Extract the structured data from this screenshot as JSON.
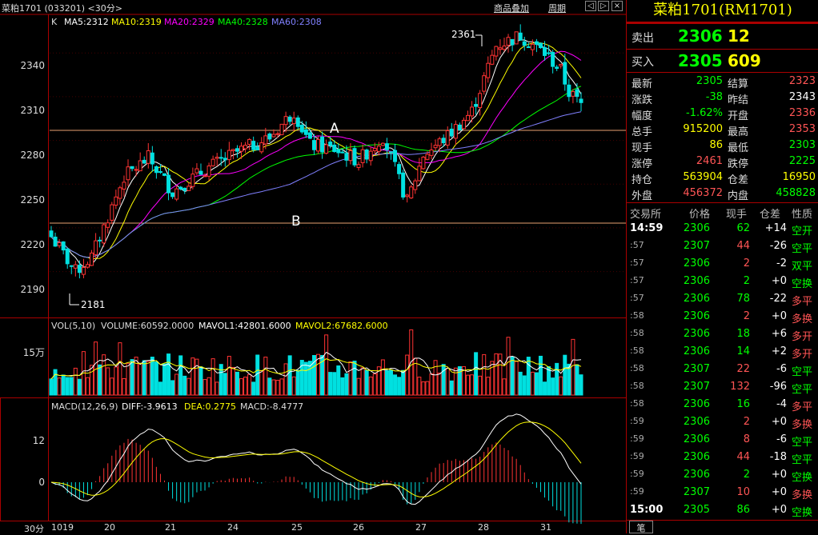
{
  "header": {
    "symbol_title": "菜粕1701 (033201) <30分>",
    "overlay_label": "商品叠加",
    "period_label": "周期"
  },
  "indicators": {
    "k_label": "K",
    "ma5": "MA5:2312",
    "ma10": "MA10:2319",
    "ma20": "MA20:2329",
    "ma40": "MA40:2328",
    "ma60": "MA60:2308",
    "vol_label": "VOL(5,10)",
    "volume": "VOLUME:60592.0000",
    "mavol1": "MAVOL1:42801.6000",
    "mavol2": "MAVOL2:67682.6000",
    "macd_label": "MACD(12,26,9)",
    "diff": "DIFF:-3.9613",
    "dea": "DEA:0.2775",
    "macd": "MACD:-8.4777"
  },
  "price_axis": [
    "2340",
    "2310",
    "2280",
    "2250",
    "2220",
    "2190"
  ],
  "vol_axis": [
    "15万"
  ],
  "macd_axis": [
    "12",
    "0"
  ],
  "annotations": {
    "high_mark": "2361",
    "low_mark": "2181",
    "line_a": "A",
    "line_b": "B"
  },
  "x_axis": {
    "period": "30分",
    "labels": [
      "1019",
      "20",
      "21",
      "24",
      "25",
      "26",
      "27",
      "28",
      "31"
    ]
  },
  "colors": {
    "up": "#ff3333",
    "down": "#00e0e0",
    "ma5": "#ffffff",
    "ma10": "#ffff00",
    "ma20": "#ff00ff",
    "ma40": "#00ff00",
    "ma60": "#8080ff"
  },
  "quote": {
    "title": "菜粕1701(RM1701)",
    "sell_label": "卖出",
    "sell_price": "2306",
    "sell_qty": "12",
    "buy_label": "买入",
    "buy_price": "2305",
    "buy_qty": "609",
    "stats": [
      [
        "最新",
        "2305",
        "结算",
        "2323"
      ],
      [
        "涨跌",
        "-38",
        "昨结",
        "2343"
      ],
      [
        "幅度",
        "-1.62%",
        "开盘",
        "2336"
      ],
      [
        "总手",
        "915200",
        "最高",
        "2353"
      ],
      [
        "现手",
        "86",
        "最低",
        "2303"
      ],
      [
        "涨停",
        "2461",
        "跌停",
        "2225"
      ],
      [
        "持仓",
        "563904",
        "仓差",
        "16950"
      ],
      [
        "外盘",
        "456372",
        "内盘",
        "458828"
      ]
    ]
  },
  "trades": {
    "headers": [
      "交易所",
      "价格",
      "现手",
      "仓差",
      "性质"
    ],
    "rows": [
      [
        "14:59",
        "2306",
        "62",
        "+14",
        "空开"
      ],
      [
        ":57",
        "2307",
        "44",
        "-26",
        "空平"
      ],
      [
        ":57",
        "2306",
        "2",
        "-2",
        "双平"
      ],
      [
        ":57",
        "2306",
        "2",
        "+0",
        "空换"
      ],
      [
        ":57",
        "2306",
        "78",
        "-22",
        "多平"
      ],
      [
        ":58",
        "2306",
        "2",
        "+0",
        "多换"
      ],
      [
        ":58",
        "2306",
        "18",
        "+6",
        "多开"
      ],
      [
        ":58",
        "2306",
        "14",
        "+2",
        "多开"
      ],
      [
        ":58",
        "2307",
        "22",
        "-6",
        "空平"
      ],
      [
        ":58",
        "2307",
        "132",
        "-96",
        "空平"
      ],
      [
        ":58",
        "2306",
        "16",
        "-4",
        "多平"
      ],
      [
        ":59",
        "2306",
        "2",
        "+0",
        "多换"
      ],
      [
        ":59",
        "2306",
        "8",
        "-6",
        "空平"
      ],
      [
        ":59",
        "2306",
        "44",
        "-18",
        "空平"
      ],
      [
        ":59",
        "2306",
        "2",
        "+0",
        "空换"
      ],
      [
        ":59",
        "2307",
        "10",
        "+0",
        "多换"
      ],
      [
        "15:00",
        "2305",
        "86",
        "+0",
        "空换"
      ]
    ],
    "footer_tab": "笔"
  }
}
